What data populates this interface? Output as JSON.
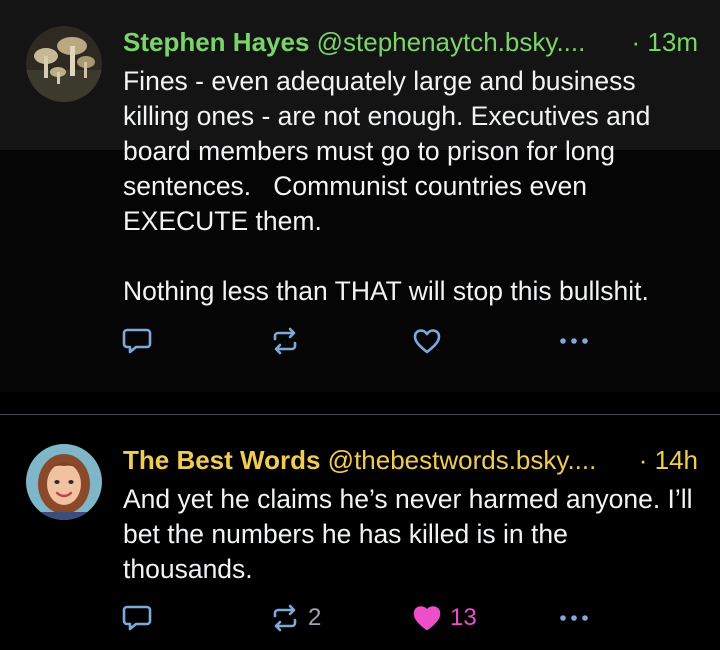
{
  "posts": [
    {
      "author_name": "Stephen Hayes",
      "author_handle": "@stephenaytch.bsky....",
      "time": "· 13m",
      "text": "Fines - even adequately large and business killing ones - are not enough. Executives and board members must go to prison for long sentences.   Communist countries even EXECUTE them.\n\nNothing less than THAT will stop this bullshit.",
      "name_color": "#7bd46a",
      "avatar_icon": "mushroom-photo-avatar",
      "repost_count": "",
      "like_count": "",
      "liked": false
    },
    {
      "author_name": "The Best Words",
      "author_handle": "@thebestwords.bsky....",
      "time": "· 14h",
      "text": "And yet he claims he’s never harmed anyone. I’ll bet the numbers he has killed is in the thousands.",
      "name_color": "#f0cc55",
      "avatar_icon": "woman-illustration-avatar",
      "repost_count": "2",
      "like_count": "13",
      "liked": true,
      "like_color": "#ec4fc8"
    }
  ],
  "icons": {
    "reply": "speech-bubble-icon",
    "repost": "repost-arrows-icon",
    "like": "heart-icon",
    "more": "ellipsis-icon"
  }
}
